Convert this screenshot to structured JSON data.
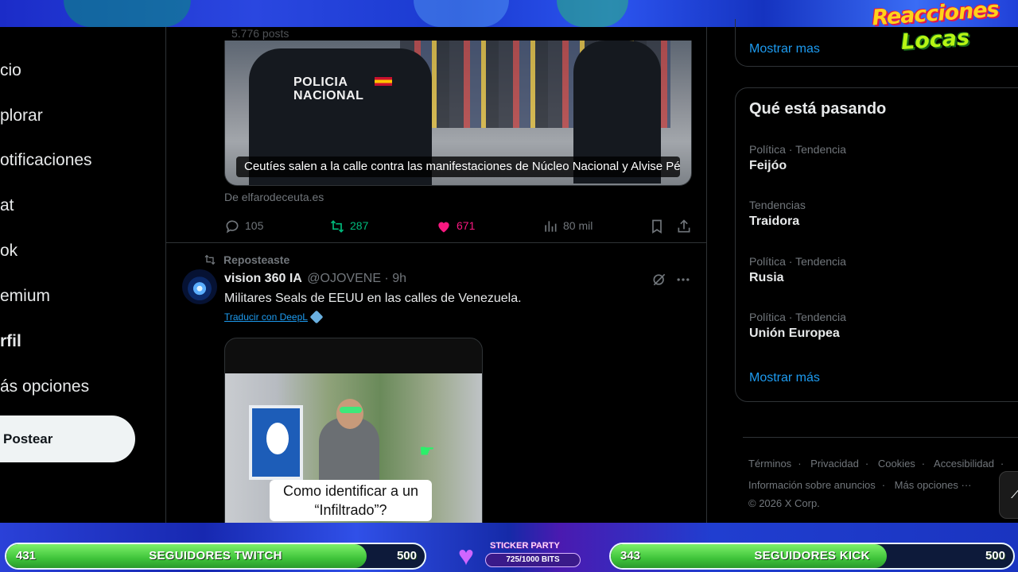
{
  "overlay": {
    "logo_line1": "Reacciones",
    "logo_line2": "Locas",
    "twitch_bar": {
      "current": "431",
      "label": "SEGUIDORES TWITCH",
      "goal": "500",
      "progress": 0.862
    },
    "kick_bar": {
      "current": "343",
      "label": "SEGUIDORES KICK",
      "goal": "500",
      "progress": 0.686
    },
    "sticker_party": {
      "title": "STICKER PARTY",
      "bits": "725/1000 BITS",
      "progress": 0.725
    }
  },
  "nav": {
    "items": [
      {
        "label": "cio",
        "icon": "home-icon"
      },
      {
        "label": "plorar",
        "icon": "search-icon"
      },
      {
        "label": "otificaciones",
        "icon": "bell-icon"
      },
      {
        "label": "at",
        "icon": "chat-icon"
      },
      {
        "label": "ok",
        "icon": "grok-icon"
      },
      {
        "label": "emium",
        "icon": "premium-icon"
      },
      {
        "label": "rfil",
        "icon": "profile-icon"
      },
      {
        "label": "ás opciones",
        "icon": "more-icon"
      }
    ],
    "post_button": "Postear"
  },
  "timeline": {
    "posts_count": "5.776 posts",
    "card": {
      "police_text": "POLICIA\nNACIONAL",
      "caption": "Ceutíes salen a la calle contra las manifestaciones de Núcleo Nacional y Alvise Pér...",
      "source": "De elfarodeceuta.es"
    },
    "actions": {
      "replies": "105",
      "reposts": "287",
      "likes": "671",
      "views": "80 mil"
    },
    "repost": {
      "label": "Reposteaste",
      "author_name": "vision 360 IA",
      "handle_time": "@OJOVENE · 9h",
      "text": "Militares Seals de EEUU en las calles de Venezuela.",
      "translate": "Traducir con DeepL",
      "video_subtitle": "Como identificar a un “Infiltrado”?"
    }
  },
  "sidebar": {
    "show_more_top": "Mostrar mas",
    "trends_title": "Qué está pasando",
    "trends": [
      {
        "context": "Política · Tendencia",
        "name": "Feijóo"
      },
      {
        "context": "Tendencias",
        "name": "Traidora"
      },
      {
        "context": "Política · Tendencia",
        "name": "Rusia"
      },
      {
        "context": "Política · Tendencia",
        "name": "Unión Europea"
      }
    ],
    "show_more": "Mostrar más",
    "footer": {
      "links": [
        "Términos",
        "Privacidad",
        "Cookies",
        "Accesibilidad"
      ],
      "links2": [
        "Información sobre anuncios",
        "Más opciones ···"
      ],
      "copyright": "© 2026 X Corp."
    }
  },
  "colors": {
    "accent": "#1d9bf0",
    "repost_green": "#00ba7c",
    "like_pink": "#f91880",
    "progress_green": "#3fc43a"
  }
}
